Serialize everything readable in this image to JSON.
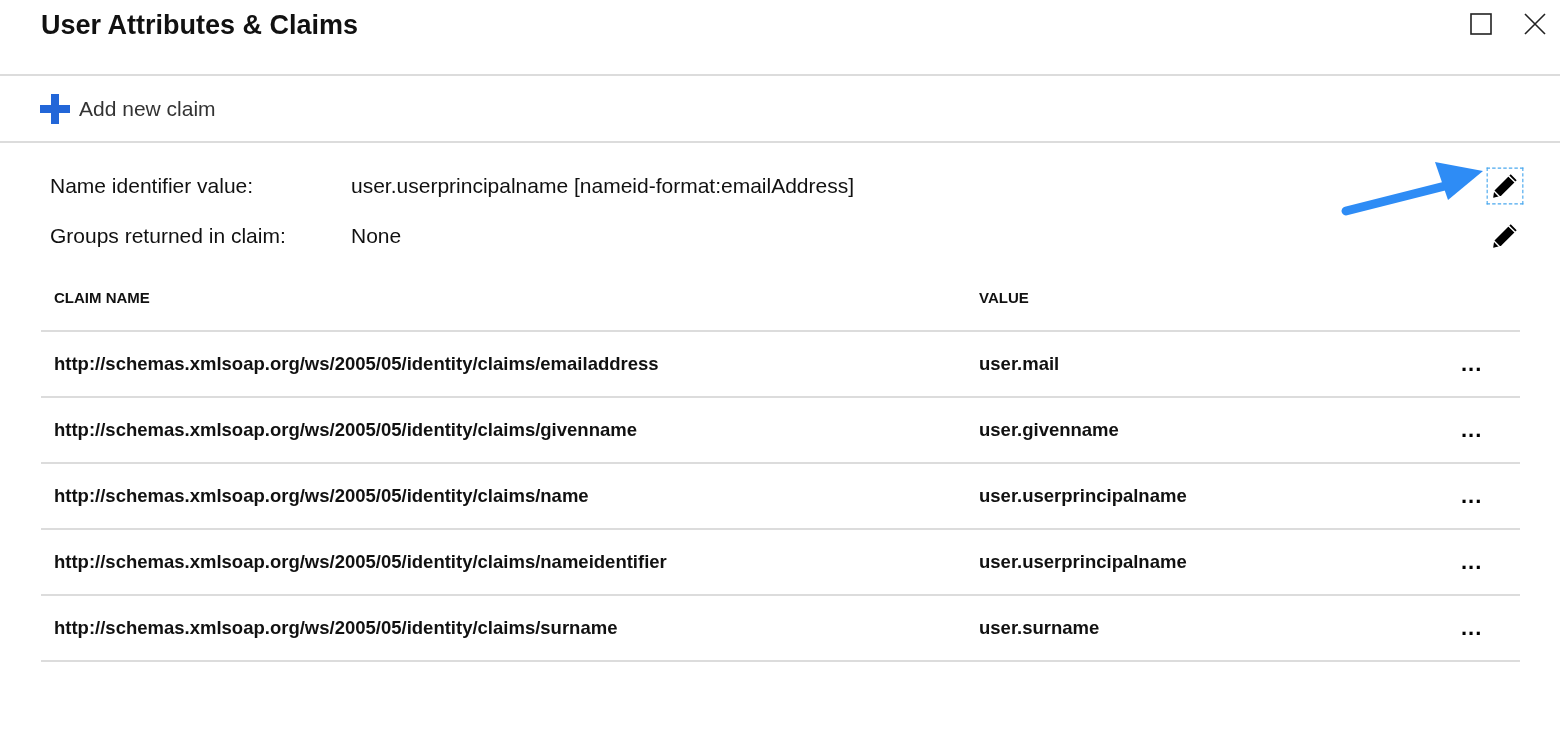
{
  "window": {
    "title": "User Attributes & Claims"
  },
  "toolbar": {
    "add_button": "Add new claim"
  },
  "attributes": [
    {
      "label": "Name identifier value:",
      "value": "user.userprincipalname [nameid-format:emailAddress]",
      "focused": true
    },
    {
      "label": "Groups returned in claim:",
      "value": "None",
      "focused": false
    }
  ],
  "pointer_arrow": true,
  "table": {
    "columns": [
      "CLAIM NAME",
      "VALUE"
    ],
    "rows": [
      {
        "claim_name": "http://schemas.xmlsoap.org/ws/2005/05/identity/claims/emailaddress",
        "value": "user.mail",
        "menu": "..."
      },
      {
        "claim_name": "http://schemas.xmlsoap.org/ws/2005/05/identity/claims/givenname",
        "value": "user.givenname",
        "menu": "..."
      },
      {
        "claim_name": "http://schemas.xmlsoap.org/ws/2005/05/identity/claims/name",
        "value": "user.userprincipalname",
        "menu": "..."
      },
      {
        "claim_name": "http://schemas.xmlsoap.org/ws/2005/05/identity/claims/nameidentifier",
        "value": "user.userprincipalname",
        "menu": "..."
      },
      {
        "claim_name": "http://schemas.xmlsoap.org/ws/2005/05/identity/claims/surname",
        "value": "user.surname",
        "menu": "..."
      }
    ]
  }
}
